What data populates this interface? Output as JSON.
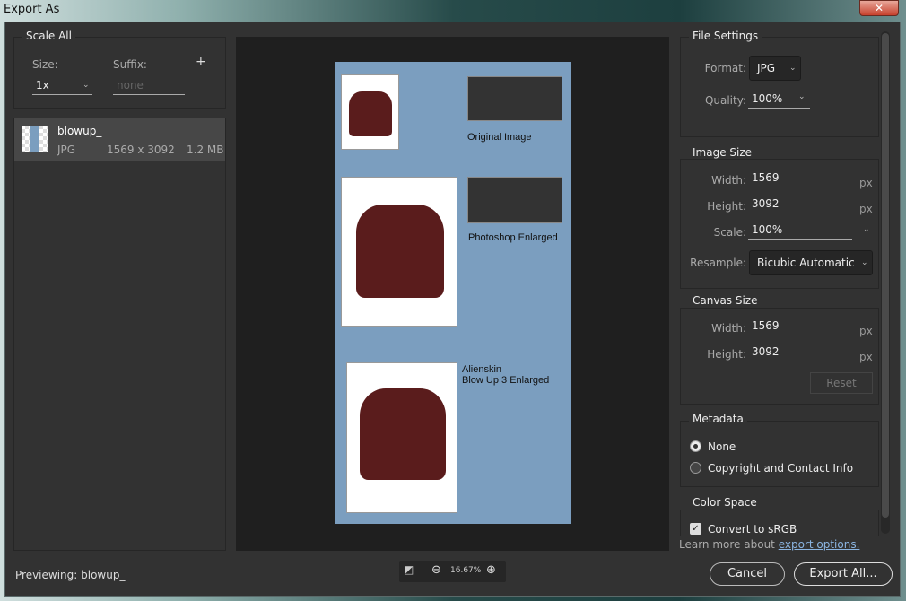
{
  "window": {
    "title": "Export As",
    "close": "✕"
  },
  "left": {
    "group_title": "Scale All",
    "size_label": "Size:",
    "size_value": "1x",
    "suffix_label": "Suffix:",
    "suffix_placeholder": "none",
    "add": "+",
    "file": {
      "name": "blowup_",
      "format": "JPG",
      "dimensions": "1569 x 3092",
      "size": "1.2 MB"
    },
    "previewing": "Previewing: blowup_"
  },
  "preview": {
    "captions": [
      "Original Image",
      "Photoshop Enlarged",
      "Alienskin",
      "Blow Up 3 Enlarged"
    ],
    "zoom": "16.67%",
    "canvas_color": "#7b9ebf"
  },
  "right": {
    "file_settings": {
      "title": "File Settings",
      "format_label": "Format:",
      "format_value": "JPG",
      "quality_label": "Quality:",
      "quality_value": "100%"
    },
    "image_size": {
      "title": "Image Size",
      "width_label": "Width:",
      "width": "1569",
      "height_label": "Height:",
      "height": "3092",
      "unit": "px",
      "scale_label": "Scale:",
      "scale": "100%",
      "resample_label": "Resample:",
      "resample": "Bicubic Automatic"
    },
    "canvas_size": {
      "title": "Canvas Size",
      "width_label": "Width:",
      "width": "1569",
      "height_label": "Height:",
      "height": "3092",
      "unit": "px",
      "reset": "Reset"
    },
    "metadata": {
      "title": "Metadata",
      "options": [
        "None",
        "Copyright and Contact Info"
      ],
      "selected": "None"
    },
    "color_space": {
      "title": "Color Space",
      "convert_label": "Convert to sRGB",
      "convert_checked": true
    },
    "learn_more": "Learn more about ",
    "learn_link": "export options."
  },
  "buttons": {
    "cancel": "Cancel",
    "export": "Export All..."
  }
}
